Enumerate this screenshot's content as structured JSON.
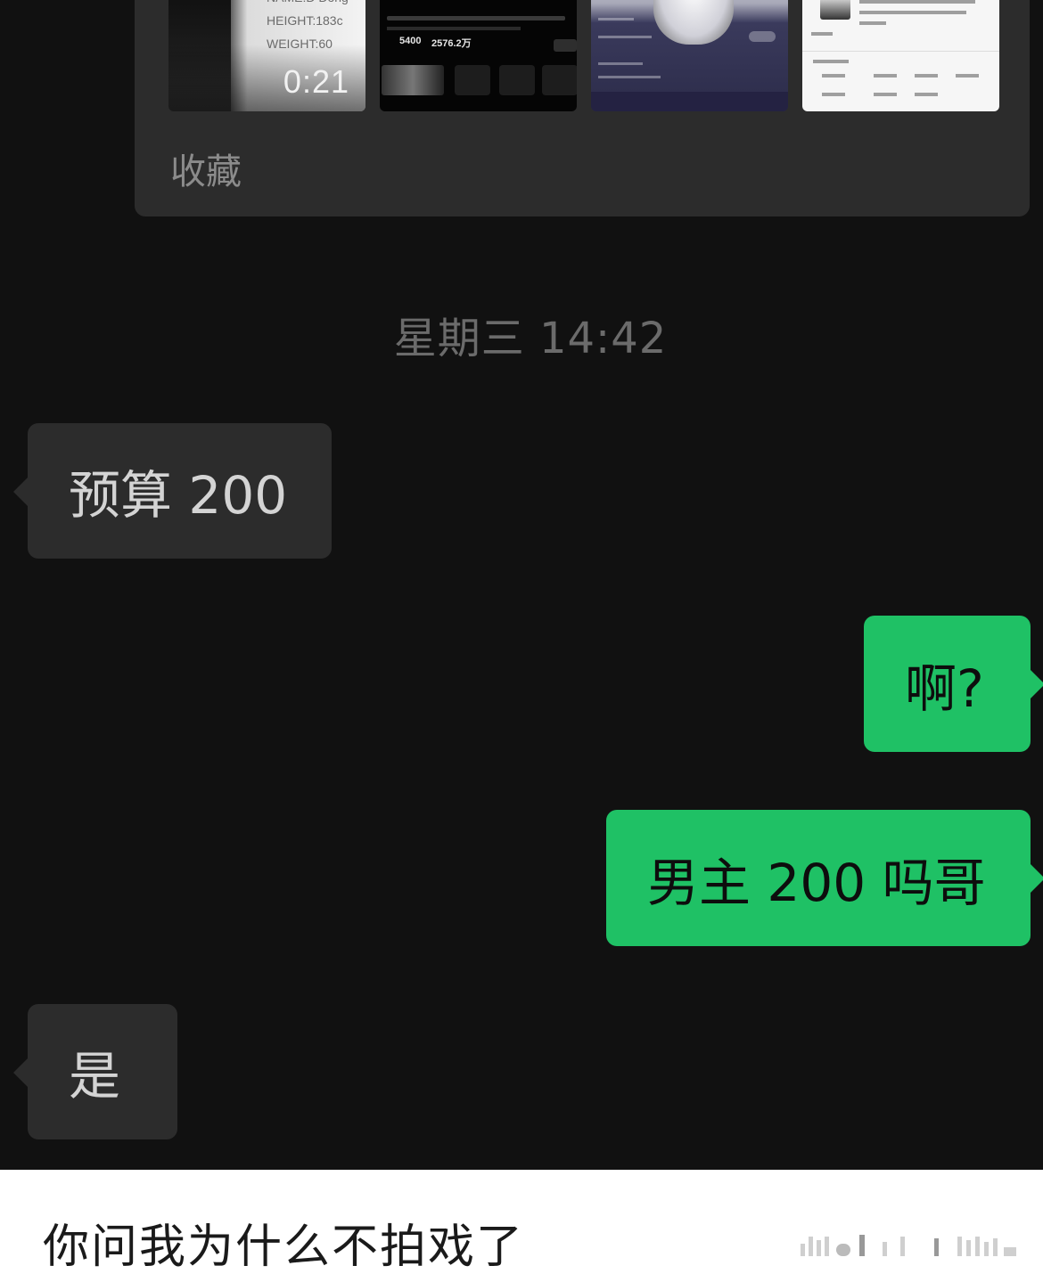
{
  "favorites": {
    "label": "收藏",
    "video": {
      "info_lines": [
        "NAME:D Dong",
        "HEIGHT:183c",
        "WEIGHT:60"
      ],
      "duration": "0:21"
    },
    "profile_stats": [
      "5400",
      "2576.2万"
    ]
  },
  "timestamp": "星期三 14:42",
  "messages": [
    {
      "side": "received",
      "text": "预算 200"
    },
    {
      "side": "sent",
      "text": "啊?"
    },
    {
      "side": "sent",
      "text": "男主 200 吗哥"
    },
    {
      "side": "received",
      "text": "是"
    }
  ],
  "caption": "你问我为什么不拍戏了",
  "colors": {
    "background": "#111111",
    "received_bubble": "#2c2c2c",
    "sent_bubble": "#1fc165",
    "caption_bar": "#ffffff"
  }
}
